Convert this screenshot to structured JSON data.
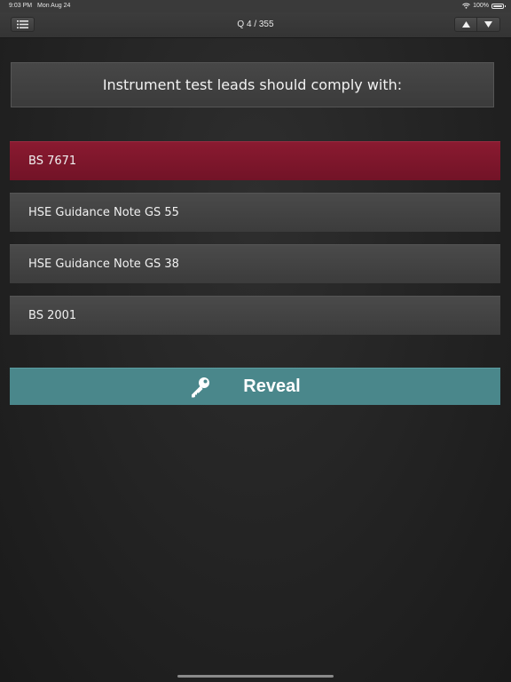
{
  "status_bar": {
    "time": "9:03 PM",
    "date": "Mon Aug 24",
    "battery": "100%",
    "battery_level": 1.0
  },
  "nav": {
    "title": "Q 4 / 355",
    "menu_icon": "list-icon",
    "up_icon": "triangle-up-icon",
    "down_icon": "triangle-down-icon"
  },
  "question": {
    "text": "Instrument test leads should comply with:"
  },
  "answers": [
    {
      "label": "BS 7671",
      "selected": true
    },
    {
      "label": "HSE Guidance Note GS 55",
      "selected": false
    },
    {
      "label": "HSE Guidance Note GS 38",
      "selected": false
    },
    {
      "label": "BS 2001",
      "selected": false
    }
  ],
  "reveal": {
    "label": "Reveal",
    "icon": "key-icon"
  },
  "colors": {
    "selected_answer": "#7d1629",
    "reveal_button": "#4a878b",
    "answer_bg": "#424242"
  }
}
